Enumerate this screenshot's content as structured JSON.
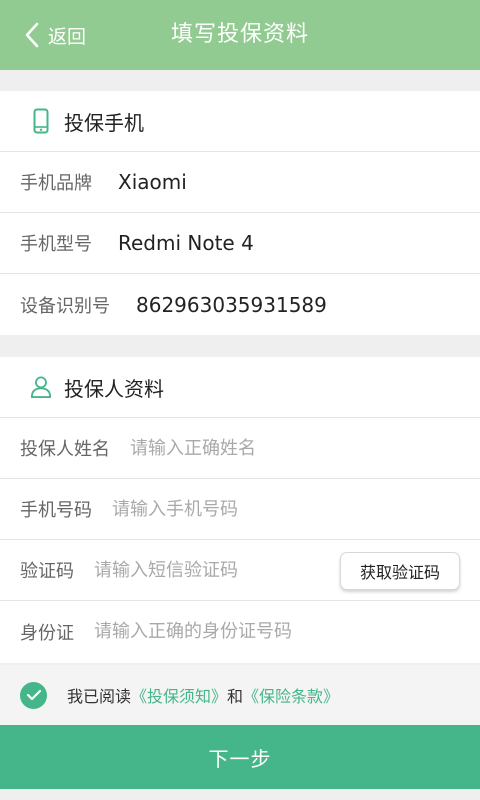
{
  "header": {
    "back_label": "返回",
    "title": "填写投保资料"
  },
  "phone_section": {
    "title": "投保手机",
    "icon": "phone-icon",
    "rows": [
      {
        "label": "手机品牌",
        "value": "Xiaomi"
      },
      {
        "label": "手机型号",
        "value": "Redmi Note 4"
      },
      {
        "label": "设备识别号",
        "value": "862963035931589"
      }
    ]
  },
  "person_section": {
    "title": "投保人资料",
    "icon": "user-icon",
    "name_label": "投保人姓名",
    "name_placeholder": "请输入正确姓名",
    "phone_label": "手机号码",
    "phone_placeholder": "请输入手机号码",
    "code_label": "验证码",
    "code_placeholder": "请输入短信验证码",
    "code_button": "获取验证码",
    "id_label": "身份证",
    "id_placeholder": "请输入正确的身份证号码"
  },
  "agreement": {
    "checked": true,
    "prefix": "我已阅读",
    "notice_link": "《投保须知》",
    "and": "和",
    "terms_link": "《保险条款》"
  },
  "next_button": "下一步",
  "colors": {
    "header": "#92cb91",
    "accent": "#45b68a"
  }
}
